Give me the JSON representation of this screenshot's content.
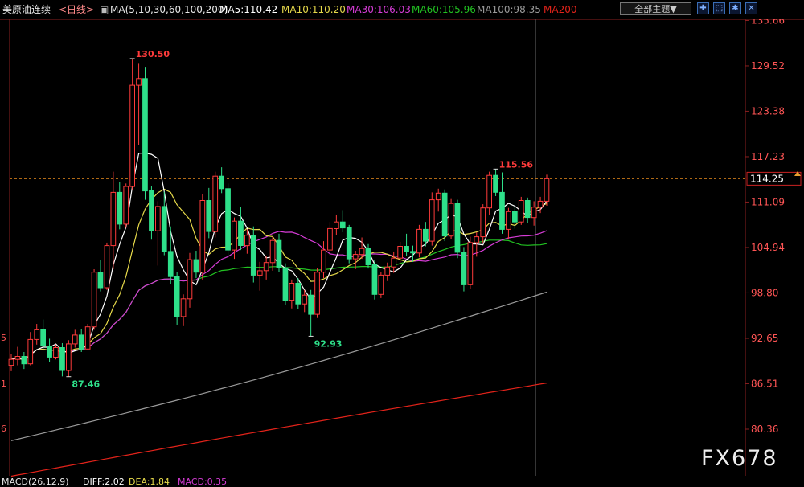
{
  "header": {
    "instrument": "美原油连续",
    "period": "<日线>",
    "ma_group": "MA(5,10,30,60,100,200)",
    "ma5": "MA5:110.42",
    "ma10": "MA10:110.20",
    "ma30": "MA30:106.03",
    "ma60": "MA60:105.96",
    "ma100": "MA100:98.35",
    "ma200": "MA200",
    "theme_button": "全部主题▼"
  },
  "colors": {
    "up": "#ff3b3b",
    "down": "#2ee08a",
    "ma5": "#ffffff",
    "ma10": "#e6d94a",
    "ma30": "#d63cd6",
    "ma60": "#22c322",
    "ma100": "#9a9a9a",
    "ma200": "#e2231a",
    "price_label": "#ff3b3b",
    "grid_price_line": "#c8781a"
  },
  "icons": [
    "crosshair-icon",
    "expand-icon",
    "settings-icon",
    "close-icon"
  ],
  "chart_data": {
    "type": "candlestick",
    "y_ticks": [
      "135.66",
      "129.52",
      "123.38",
      "117.23",
      "111.09",
      "104.94",
      "98.80",
      "92.65",
      "86.51",
      "80.36"
    ],
    "left_axis_fragments": [
      "5",
      "1",
      "6"
    ],
    "ylim": [
      77.0,
      137.0
    ],
    "current_price": "114.25",
    "annotations": [
      {
        "label": "130.50",
        "value": 130.5,
        "type": "high"
      },
      {
        "label": "115.56",
        "value": 115.56,
        "type": "high"
      },
      {
        "label": "92.93",
        "value": 92.93,
        "type": "low"
      },
      {
        "label": "87.46",
        "value": 87.46,
        "type": "low"
      }
    ],
    "candles": [
      [
        89.0,
        90.5,
        88.2,
        89.8
      ],
      [
        89.8,
        91.5,
        89.0,
        90.2
      ],
      [
        90.2,
        90.8,
        88.5,
        89.2
      ],
      [
        89.2,
        93.5,
        89.0,
        92.5
      ],
      [
        92.5,
        94.6,
        91.8,
        93.8
      ],
      [
        93.8,
        95.2,
        91.0,
        91.6
      ],
      [
        91.6,
        92.6,
        89.4,
        90.1
      ],
      [
        90.1,
        91.8,
        89.8,
        91.4
      ],
      [
        91.4,
        92.0,
        87.5,
        88.3
      ],
      [
        88.3,
        92.4,
        87.46,
        91.9
      ],
      [
        91.9,
        93.8,
        91.4,
        93.1
      ],
      [
        93.1,
        93.9,
        90.8,
        91.2
      ],
      [
        91.2,
        94.6,
        91.1,
        94.2
      ],
      [
        94.2,
        102.0,
        93.8,
        101.6
      ],
      [
        101.6,
        103.2,
        99.0,
        99.5
      ],
      [
        99.5,
        105.6,
        99.2,
        105.2
      ],
      [
        105.2,
        115.2,
        102.0,
        112.4
      ],
      [
        112.4,
        113.8,
        107.4,
        108.1
      ],
      [
        108.1,
        113.6,
        107.6,
        113.2
      ],
      [
        113.2,
        130.5,
        112.8,
        126.9
      ],
      [
        126.9,
        129.8,
        118.8,
        127.8
      ],
      [
        127.8,
        129.4,
        111.4,
        112.6
      ],
      [
        112.6,
        113.2,
        106.0,
        107.2
      ],
      [
        107.2,
        111.2,
        102.5,
        110.5
      ],
      [
        110.5,
        112.5,
        103.9,
        104.4
      ],
      [
        104.4,
        107.8,
        100.0,
        101.0
      ],
      [
        101.0,
        101.6,
        94.5,
        95.6
      ],
      [
        95.6,
        98.6,
        94.3,
        98.0
      ],
      [
        98.0,
        104.2,
        96.8,
        103.3
      ],
      [
        103.3,
        104.5,
        100.8,
        101.6
      ],
      [
        101.6,
        112.2,
        100.6,
        111.3
      ],
      [
        111.3,
        113.0,
        106.2,
        107.1
      ],
      [
        107.1,
        115.2,
        106.3,
        114.6
      ],
      [
        114.6,
        115.8,
        112.3,
        112.9
      ],
      [
        112.9,
        113.6,
        103.9,
        104.6
      ],
      [
        104.6,
        109.0,
        103.4,
        108.5
      ],
      [
        108.5,
        110.4,
        104.6,
        105.2
      ],
      [
        105.2,
        107.4,
        104.1,
        106.6
      ],
      [
        106.6,
        107.8,
        100.2,
        101.2
      ],
      [
        101.2,
        103.0,
        99.1,
        101.8
      ],
      [
        101.8,
        103.8,
        100.6,
        102.9
      ],
      [
        102.9,
        106.4,
        101.8,
        105.9
      ],
      [
        105.9,
        106.8,
        101.6,
        102.2
      ],
      [
        102.2,
        102.8,
        97.2,
        97.8
      ],
      [
        97.8,
        100.6,
        96.7,
        100.1
      ],
      [
        100.1,
        100.8,
        96.6,
        97.3
      ],
      [
        97.3,
        99.2,
        96.2,
        98.5
      ],
      [
        98.5,
        99.2,
        92.93,
        95.9
      ],
      [
        95.9,
        102.2,
        95.4,
        101.6
      ],
      [
        101.6,
        105.8,
        100.8,
        104.6
      ],
      [
        104.6,
        108.4,
        103.8,
        107.5
      ],
      [
        107.5,
        109.4,
        106.6,
        108.4
      ],
      [
        108.4,
        110.0,
        107.0,
        107.6
      ],
      [
        107.6,
        108.0,
        102.8,
        103.4
      ],
      [
        103.4,
        104.5,
        102.0,
        104.0
      ],
      [
        104.0,
        106.3,
        103.4,
        104.8
      ],
      [
        104.8,
        105.4,
        102.1,
        102.6
      ],
      [
        102.6,
        103.2,
        97.9,
        98.6
      ],
      [
        98.6,
        101.6,
        98.1,
        101.2
      ],
      [
        101.2,
        102.9,
        100.4,
        102.3
      ],
      [
        102.3,
        104.4,
        101.5,
        103.5
      ],
      [
        103.5,
        105.7,
        102.8,
        105.1
      ],
      [
        105.1,
        106.8,
        103.8,
        104.4
      ],
      [
        104.4,
        105.2,
        103.0,
        104.2
      ],
      [
        104.2,
        108.0,
        103.6,
        107.4
      ],
      [
        107.4,
        108.4,
        105.1,
        105.8
      ],
      [
        105.8,
        112.4,
        105.2,
        111.4
      ],
      [
        111.4,
        112.9,
        109.8,
        112.3
      ],
      [
        112.3,
        112.8,
        105.8,
        106.5
      ],
      [
        106.5,
        111.5,
        106.1,
        110.9
      ],
      [
        110.9,
        111.4,
        103.5,
        104.3
      ],
      [
        104.3,
        105.0,
        99.0,
        99.9
      ],
      [
        99.9,
        106.4,
        99.3,
        105.6
      ],
      [
        105.6,
        107.0,
        103.7,
        106.4
      ],
      [
        106.4,
        110.8,
        105.6,
        110.3
      ],
      [
        110.3,
        115.2,
        109.4,
        114.7
      ],
      [
        114.7,
        115.56,
        111.9,
        112.4
      ],
      [
        112.4,
        115.1,
        106.8,
        107.4
      ],
      [
        107.4,
        110.3,
        106.1,
        109.8
      ],
      [
        109.8,
        110.4,
        107.5,
        108.4
      ],
      [
        108.4,
        111.8,
        108.0,
        111.3
      ],
      [
        111.3,
        111.7,
        108.2,
        109.0
      ],
      [
        109.0,
        111.2,
        107.9,
        110.4
      ],
      [
        110.4,
        111.8,
        109.6,
        111.2
      ],
      [
        111.2,
        114.8,
        110.6,
        114.25
      ]
    ]
  },
  "macd": {
    "title": "MACD(26,12,9)",
    "diff": "DIFF:2.02",
    "dea": "DEA:1.84",
    "macd": "MACD:0.35"
  },
  "watermark": "FX678"
}
